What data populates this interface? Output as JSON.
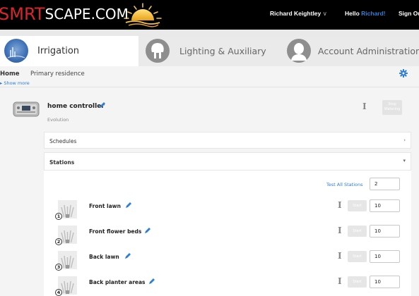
{
  "header": {
    "logo_part1": "SMRT",
    "logo_part2": "SCAPE.COM",
    "user_menu": "Richard Keightley",
    "user_caret": "∨",
    "hello_prefix": "Hello ",
    "hello_name": "Richard!",
    "signout": "Sign Out"
  },
  "tabs": [
    {
      "label": "Irrigation",
      "icon": "water-drop-icon",
      "active": true
    },
    {
      "label": "Lighting & Auxiliary",
      "icon": "lightbulb-icon",
      "active": false
    },
    {
      "label": "Account Administration",
      "icon": "person-icon",
      "active": false
    }
  ],
  "breadcrumb": {
    "home": "Home",
    "location": "Primary residence",
    "show_more": "▸ Show more"
  },
  "controller": {
    "name": "home controller",
    "model": "Evolution",
    "info": "I",
    "stop_label": "Stop Watering"
  },
  "panels": {
    "schedules": "Schedules",
    "schedules_chevron": "›",
    "stations": "Stations",
    "stations_chevron": "▾"
  },
  "test_all": {
    "label": "Test All Stations",
    "value": "2"
  },
  "stations": [
    {
      "number": "1",
      "name": "Front lawn",
      "start": "Start",
      "duration": "10",
      "info": "I"
    },
    {
      "number": "2",
      "name": "Front flower beds",
      "start": "Start",
      "duration": "10",
      "info": "I"
    },
    {
      "number": "3",
      "name": "Back lawn",
      "start": "Start",
      "duration": "10",
      "info": "I"
    },
    {
      "number": "4",
      "name": "Back planter areas",
      "start": "Start",
      "duration": "10",
      "info": "I"
    }
  ],
  "colors": {
    "brand_red": "#d7262b",
    "link_blue": "#2e7ed6",
    "topbar": "#000000"
  }
}
